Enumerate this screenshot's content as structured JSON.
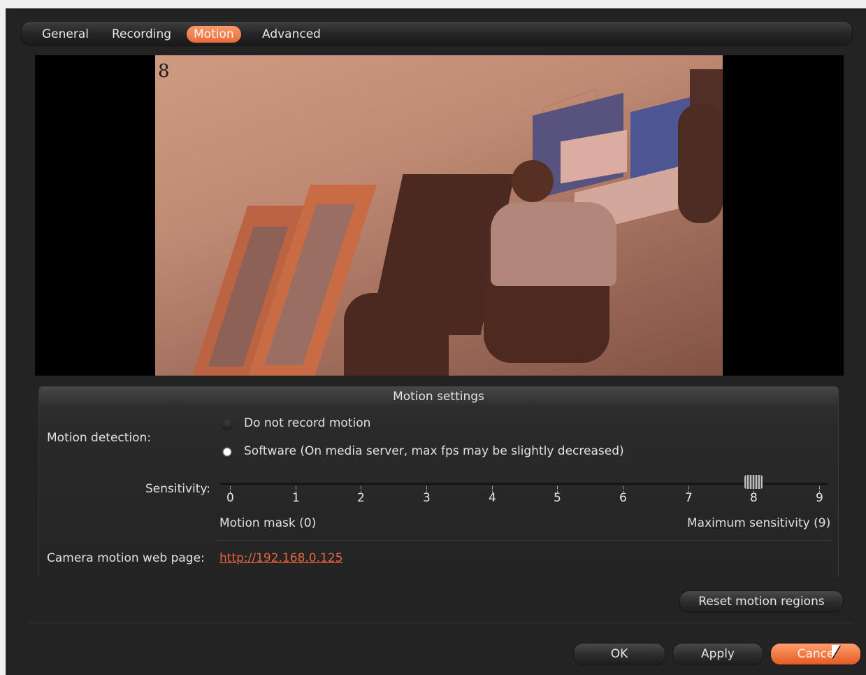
{
  "tabs": [
    {
      "label": "General",
      "active": false
    },
    {
      "label": "Recording",
      "active": false
    },
    {
      "label": "Motion",
      "active": true
    },
    {
      "label": "Advanced",
      "active": false
    }
  ],
  "video": {
    "camera_number": "8"
  },
  "motion_settings": {
    "title": "Motion settings",
    "detection_label": "Motion detection:",
    "options": [
      {
        "label": "Do not record motion",
        "selected": false
      },
      {
        "label": "Software (On media server, max fps may be slightly decreased)",
        "selected": true
      }
    ],
    "sensitivity_label": "Sensitivity:",
    "sensitivity_ticks": [
      "0",
      "1",
      "2",
      "3",
      "4",
      "5",
      "6",
      "7",
      "8",
      "9"
    ],
    "sensitivity_value": 8,
    "min_caption": "Motion mask (0)",
    "max_caption": "Maximum sensitivity (9)",
    "web_page_label": "Camera motion web page:",
    "web_page_link": "http://192.168.0.125"
  },
  "buttons": {
    "reset": "Reset motion regions",
    "ok": "OK",
    "apply": "Apply",
    "cancel": "Cance"
  },
  "colors": {
    "accent": "#e96a3a",
    "link": "#e8643c",
    "background": "#232323"
  }
}
